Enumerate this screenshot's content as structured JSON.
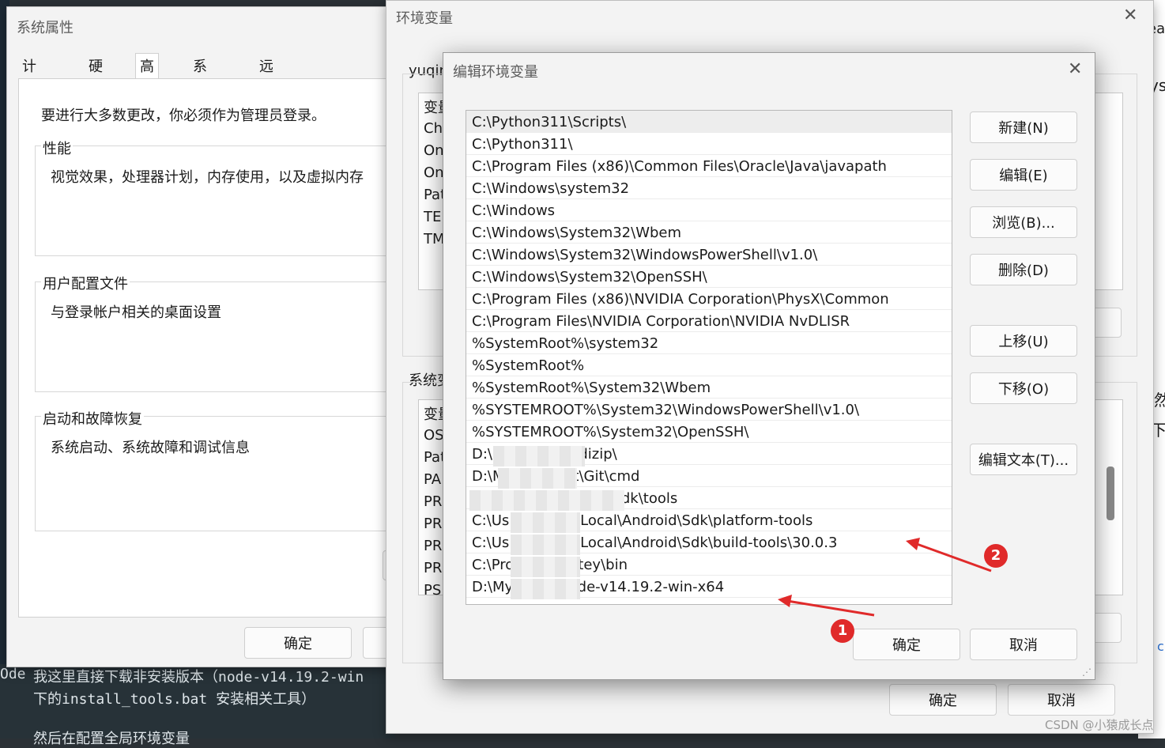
{
  "desktop": {
    "right_frag": [
      "ea",
      "ys",
      "然",
      "下",
      "c"
    ],
    "left_frag": [
      "Ode"
    ],
    "bottom_lines": [
      "我这里直接下载非安装版本（node-v14.19.2-win",
      "下的install_tools.bat 安装相关工具）",
      "然后在配置全局环境变量"
    ],
    "watermark": "CSDN @小猿成长点"
  },
  "system_properties": {
    "title": "系统属性",
    "tabs": [
      "计算机名",
      "硬件",
      "高级",
      "系统保护",
      "远程"
    ],
    "admin_note": "要进行大多数更改，你必须作为管理员登录。",
    "groups": [
      {
        "title": "性能",
        "desc": "视觉效果，处理器计划，内存使用，以及虚拟内存"
      },
      {
        "title": "用户配置文件",
        "desc": "与登录帐户相关的桌面设置"
      },
      {
        "title": "启动和故障恢复",
        "desc": "系统启动、系统故障和调试信息"
      }
    ],
    "ok_label": "确定"
  },
  "env_vars": {
    "title": "环境变量",
    "user_header": "yuqin",
    "user_vars": [
      "变量",
      "Ch",
      "On",
      "On",
      "Pat",
      "TEI",
      "TM"
    ],
    "sys_header": "系统变",
    "sys_vars": [
      "变量",
      "OS",
      "Pat",
      "PA",
      "PR",
      "PR",
      "PR",
      "PR",
      "PSI"
    ],
    "ok_label": "确定",
    "cancel_label": "取消"
  },
  "edit_env": {
    "title": "编辑环境变量",
    "paths": [
      "C:\\Python311\\Scripts\\",
      "C:\\Python311\\",
      "C:\\Program Files (x86)\\Common Files\\Oracle\\Java\\javapath",
      "C:\\Windows\\system32",
      "C:\\Windows",
      "C:\\Windows\\System32\\Wbem",
      "C:\\Windows\\System32\\WindowsPowerShell\\v1.0\\",
      "C:\\Windows\\System32\\OpenSSH\\",
      "C:\\Program Files (x86)\\NVIDIA Corporation\\PhysX\\Common",
      "C:\\Program Files\\NVIDIA Corporation\\NVIDIA NvDLISR",
      "%SystemRoot%\\system32",
      "%SystemRoot%",
      "%SystemRoot%\\System32\\Wbem",
      "%SYSTEMROOT%\\System32\\WindowsPowerShell\\v1.0\\",
      "%SYSTEMROOT%\\System32\\OpenSSH\\",
      "D:\\M            YYDS\\Bandizip\\",
      "D:\\M            dYYDS\\git\\Git\\cmd",
      "                     Data\\Local\\Android\\Sdk\\tools",
      "C:\\Us             AppData\\Local\\Android\\Sdk\\platform-tools",
      "C:\\Us             AppData\\Local\\Android\\Sdk\\build-tools\\30.0.3",
      "C:\\Pro            \\chocolatey\\bin",
      "D:\\My             YYDS\\node-v14.19.2-win-x64"
    ],
    "buttons": {
      "new": "新建(N)",
      "edit": "编辑(E)",
      "browse": "浏览(B)...",
      "delete": "删除(D)",
      "up": "上移(U)",
      "down": "下移(O)",
      "edit_text": "编辑文本(T)...",
      "ok": "确定",
      "cancel": "取消"
    },
    "annotations": [
      "1",
      "2"
    ]
  }
}
